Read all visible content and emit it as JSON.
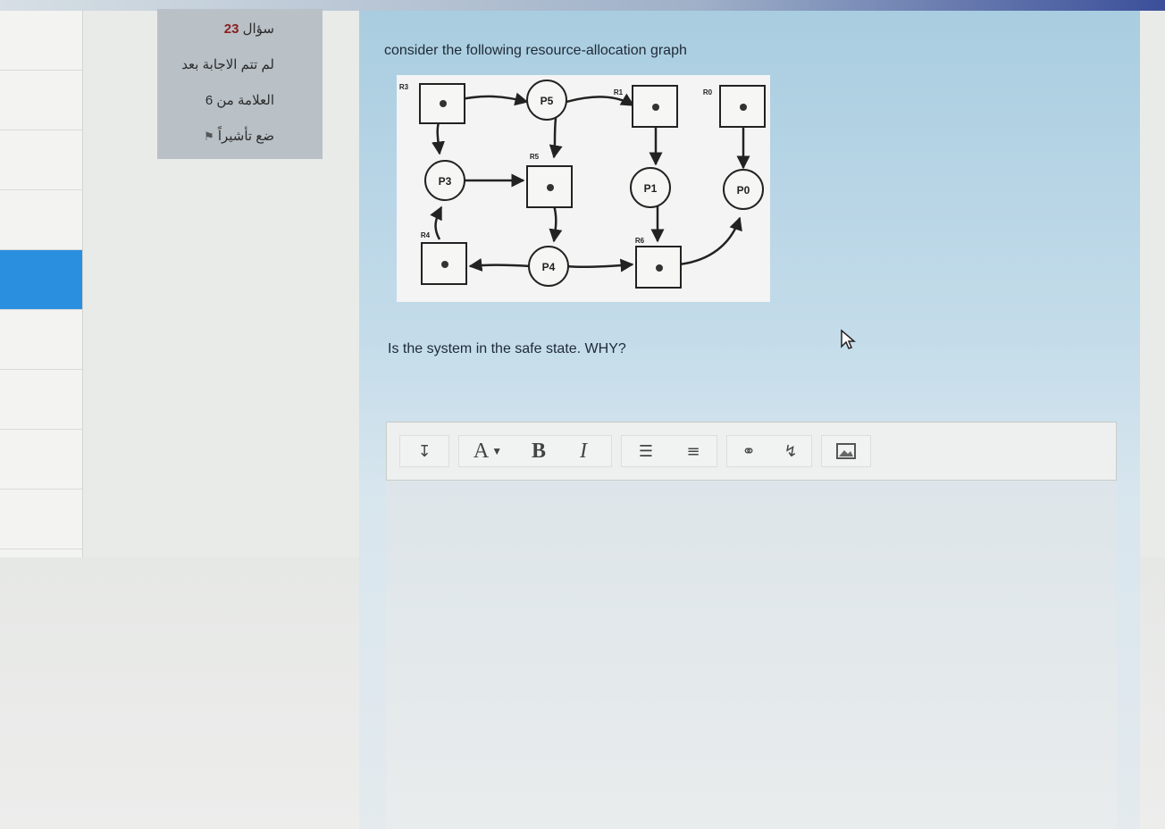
{
  "question_info": {
    "number_label": "سؤال",
    "number": "23",
    "status": "لم تتم الاجابة بعد",
    "score": "العلامة من 6",
    "flag_label": "ضع تأشيراً"
  },
  "question": {
    "text": "consider the following resource-allocation graph",
    "ask": "Is the system in the safe state. WHY?"
  },
  "graph": {
    "processes": [
      "P5",
      "P3",
      "P1",
      "P0",
      "P4"
    ],
    "resources": [
      "R3",
      "R1",
      "R0",
      "R5",
      "R4",
      "R6"
    ]
  },
  "toolbar": {
    "paragraph_icon": "paragraph-icon",
    "font_color": "A",
    "bold": "B",
    "italic": "I",
    "bullet_list_icon": "bullet-list-icon",
    "numbered_list_icon": "numbered-list-icon",
    "link_icon": "link-icon",
    "unlink_icon": "unlink-icon",
    "image_icon": "image-icon"
  }
}
